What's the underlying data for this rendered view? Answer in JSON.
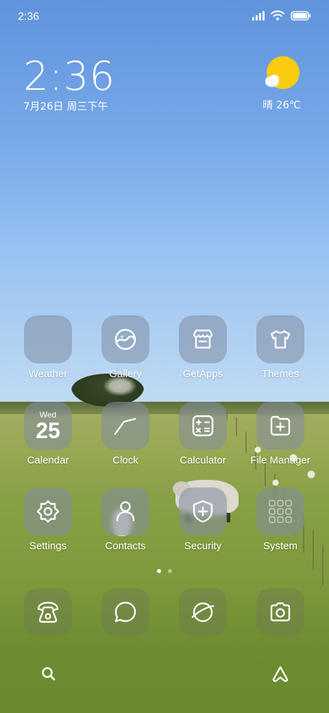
{
  "status_bar": {
    "time": "2:36",
    "icons": [
      "signal-icon",
      "wifi-icon",
      "battery-icon"
    ]
  },
  "clock_widget": {
    "time": "2:36",
    "date": "7月26日 周三下午"
  },
  "weather_widget": {
    "icon": "sunny-cloud-icon",
    "text": "晴 26℃"
  },
  "apps": {
    "row1": [
      {
        "label": "Weather",
        "icon": "weather-icon"
      },
      {
        "label": "Gallery",
        "icon": "gallery-icon"
      },
      {
        "label": "GetApps",
        "icon": "store-icon"
      },
      {
        "label": "Themes",
        "icon": "tshirt-icon"
      }
    ],
    "row2": [
      {
        "label": "Calendar",
        "icon": "calendar-icon",
        "day": "Wed",
        "date": "25"
      },
      {
        "label": "Clock",
        "icon": "clock-icon"
      },
      {
        "label": "Calculator",
        "icon": "calculator-icon"
      },
      {
        "label": "File Manager",
        "icon": "folder-icon"
      }
    ],
    "row3": [
      {
        "label": "Settings",
        "icon": "gear-icon"
      },
      {
        "label": "Contacts",
        "icon": "person-icon"
      },
      {
        "label": "Security",
        "icon": "shield-icon"
      },
      {
        "label": "System",
        "icon": "folder-grid-icon"
      }
    ]
  },
  "page_indicator": {
    "pages": 2,
    "current": 1
  },
  "dock": [
    {
      "icon": "phone-icon"
    },
    {
      "icon": "message-icon"
    },
    {
      "icon": "browser-icon"
    },
    {
      "icon": "camera-icon"
    }
  ],
  "bottom_bar": {
    "left_icon": "search-icon",
    "right_icon": "assistant-icon"
  },
  "colors": {
    "sky_top": "#5f93dc",
    "grass": "#7e9a3c",
    "sun": "#f9cc12",
    "tile": "#828ca0"
  }
}
